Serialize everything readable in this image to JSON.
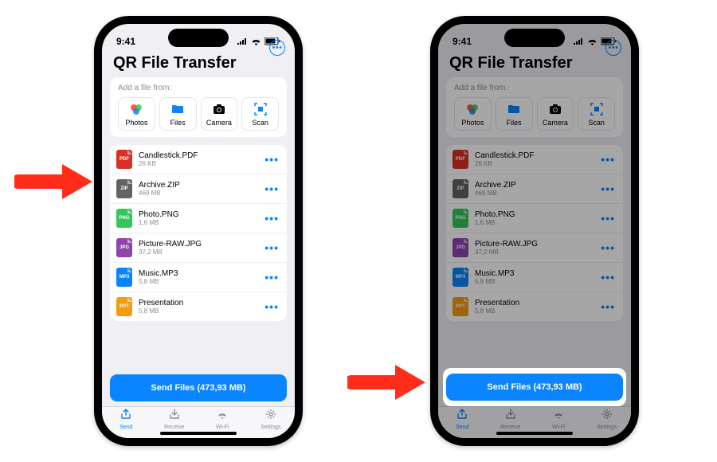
{
  "status": {
    "time": "9:41"
  },
  "app": {
    "title": "QR File Transfer"
  },
  "addFile": {
    "label": "Add a file from:",
    "sources": [
      {
        "label": "Photos",
        "icon": "photos-icon"
      },
      {
        "label": "Files",
        "icon": "folder-icon"
      },
      {
        "label": "Camera",
        "icon": "camera-icon"
      },
      {
        "label": "Scan",
        "icon": "scan-icon"
      }
    ]
  },
  "files": [
    {
      "name": "Candlestick.PDF",
      "size": "26 KB",
      "badge": "PDF",
      "color": "#d93025"
    },
    {
      "name": "Archive.ZIP",
      "size": "469 MB",
      "badge": "ZIP",
      "color": "#636366"
    },
    {
      "name": "Photo.PNG",
      "size": "1,6 MB",
      "badge": "PNG",
      "color": "#34c759"
    },
    {
      "name": "Picture-RAW.JPG",
      "size": "37,2 MB",
      "badge": "JPG",
      "color": "#8e44ad"
    },
    {
      "name": "Music.MP3",
      "size": "5,8 MB",
      "badge": "MP3",
      "color": "#0a84ff"
    },
    {
      "name": "Presentation",
      "size": "5,8 MB",
      "badge": "PPT",
      "color": "#f39c12"
    }
  ],
  "sendButton": {
    "label": "Send Files (473,93 MB)"
  },
  "tabs": [
    {
      "label": "Send",
      "icon": "share-icon",
      "active": true
    },
    {
      "label": "Receive",
      "icon": "inbox-icon",
      "active": false
    },
    {
      "label": "Wi-Fi",
      "icon": "wifi-icon",
      "active": false
    },
    {
      "label": "Settings",
      "icon": "gear-icon",
      "active": false
    }
  ]
}
